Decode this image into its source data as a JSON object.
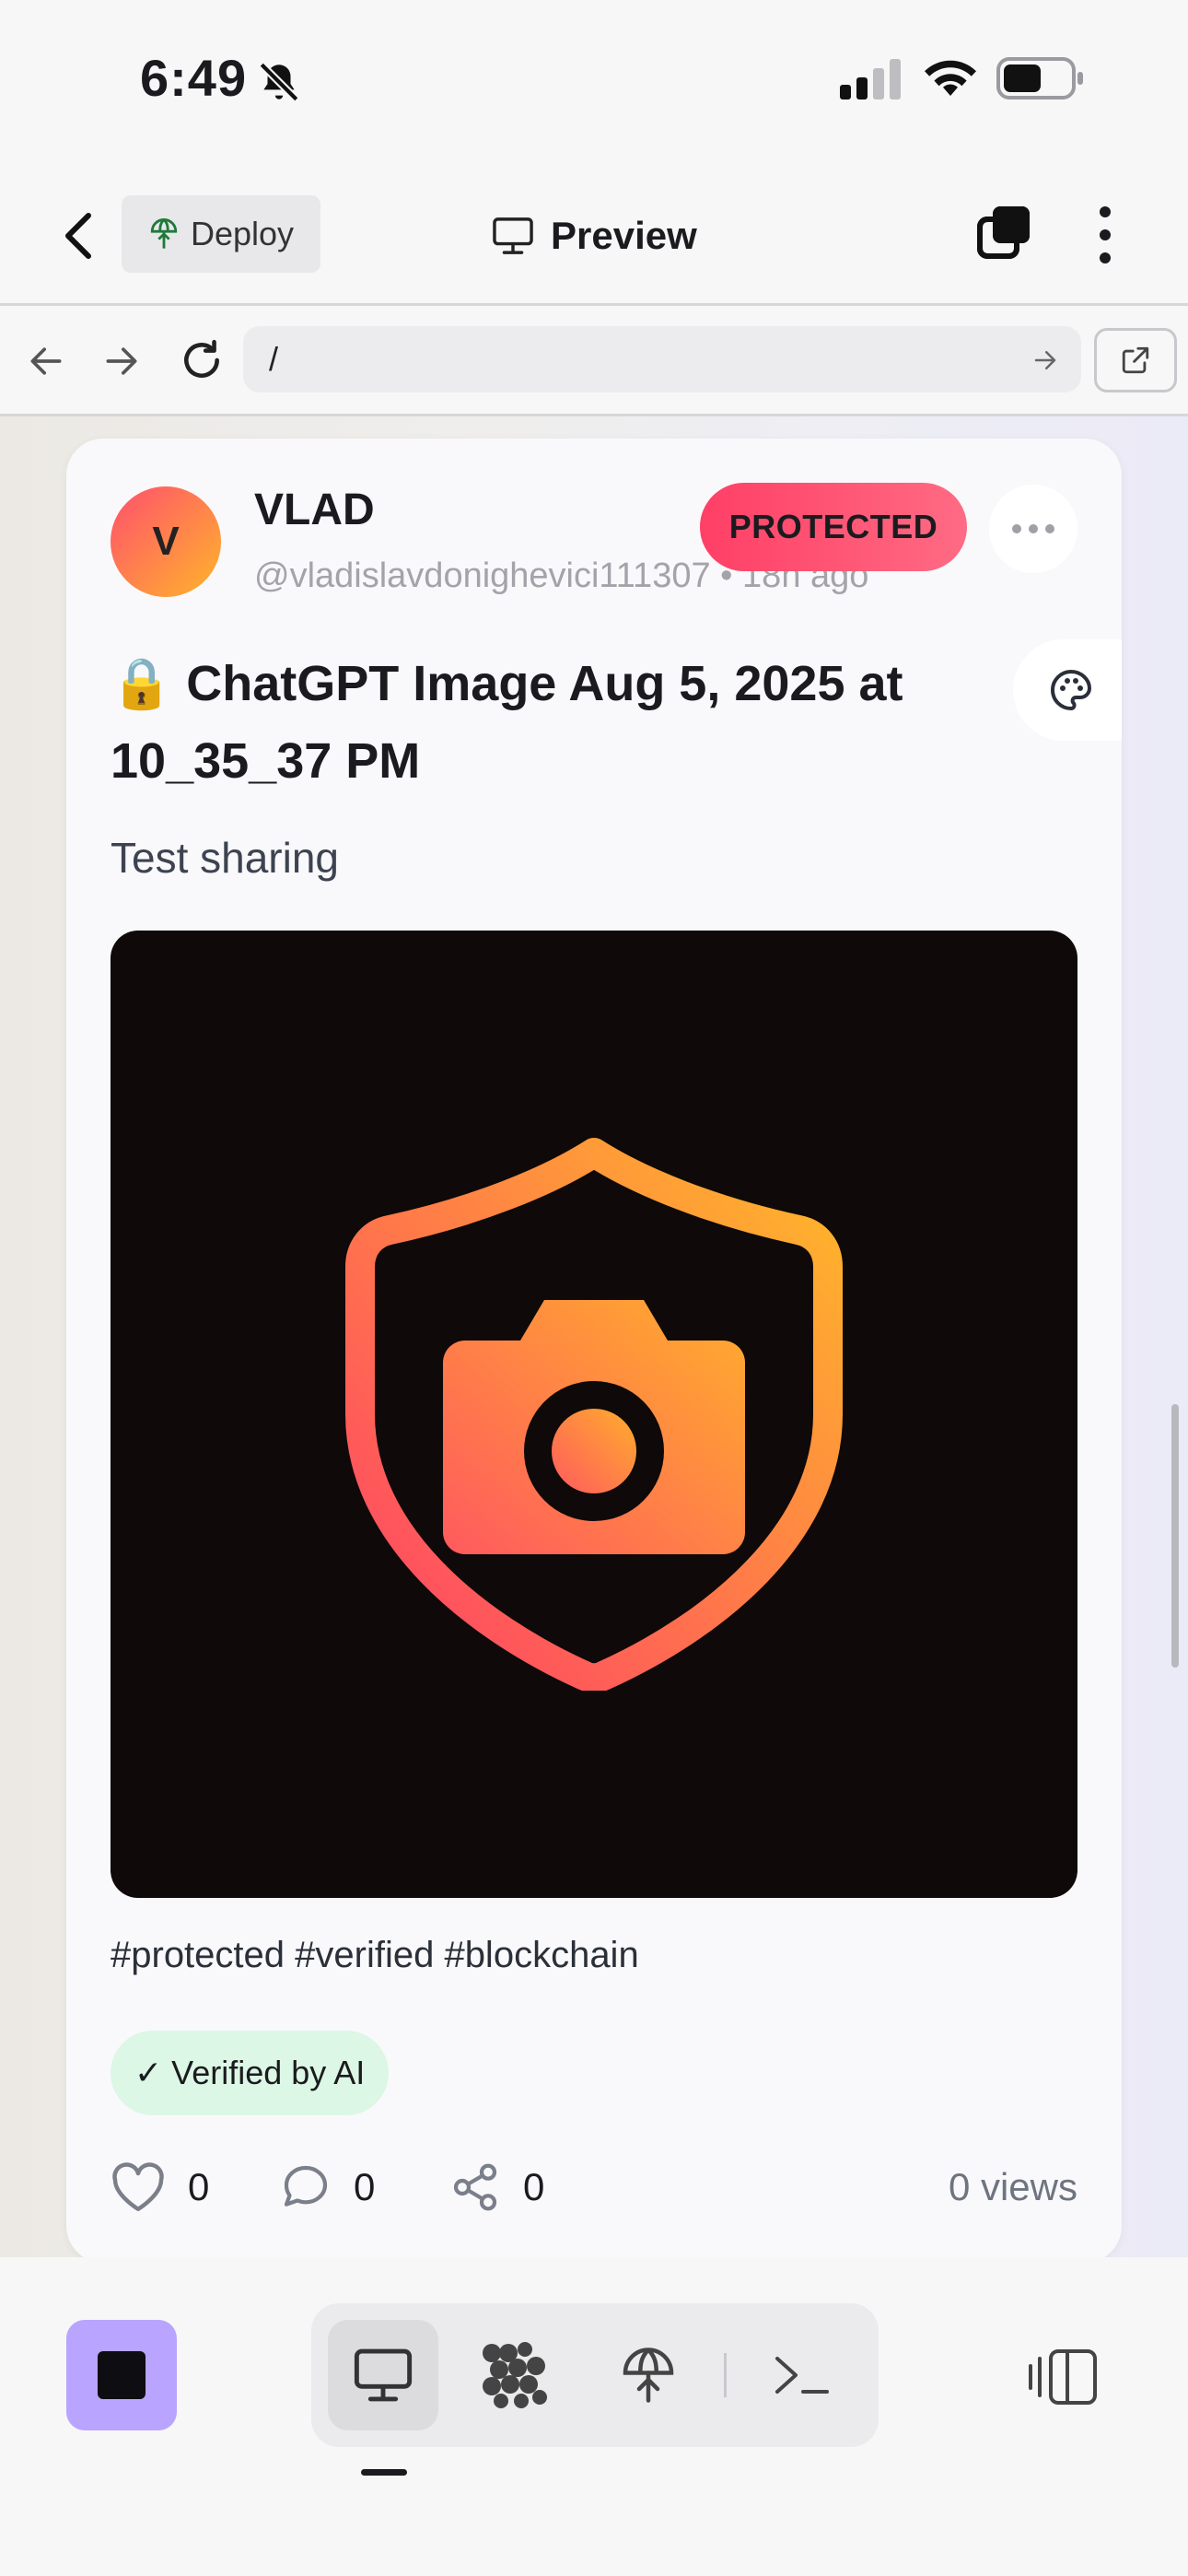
{
  "status_bar": {
    "time": "6:49",
    "icons": [
      "bell-slash-icon",
      "signal-icon",
      "wifi-icon",
      "battery-icon"
    ]
  },
  "header": {
    "back_icon": "chevron-left-icon",
    "deploy_label": "Deploy",
    "title": "Preview",
    "right_icons": [
      "tabs-icon",
      "more-vertical-icon"
    ]
  },
  "browser": {
    "url": "/",
    "icons": [
      "arrow-left-icon",
      "arrow-right-icon",
      "reload-icon",
      "arrow-right-small-icon",
      "open-external-icon"
    ]
  },
  "post": {
    "avatar_initial": "V",
    "author_name": "VLAD",
    "author_handle": "@vladislavdonighevici111307",
    "separator": "•",
    "time_ago": "18h ago",
    "badge": "PROTECTED",
    "title_icon": "🔒",
    "title": "ChatGPT Image Aug 5, 2025 at 10_35_37 PM",
    "description": "Test sharing",
    "image_icon": "shield-camera-icon",
    "hashtags": "#protected #verified #blockchain",
    "verified_label": "✓ Verified by AI",
    "likes": "0",
    "comments": "0",
    "shares": "0",
    "views": "0 views"
  },
  "bottom_toolbar": {
    "icons": [
      "stop-icon",
      "monitor-icon",
      "ai-icon",
      "deploy-icon",
      "terminal-icon",
      "split-view-icon"
    ],
    "active": "monitor-icon"
  },
  "colors": {
    "accent_gradient_start": "#ff4f6e",
    "accent_gradient_end": "#ffb52a",
    "badge_protected": "#ff4f70",
    "verified_bg": "#dcf7e5",
    "stop_button": "#b9a4ff"
  }
}
